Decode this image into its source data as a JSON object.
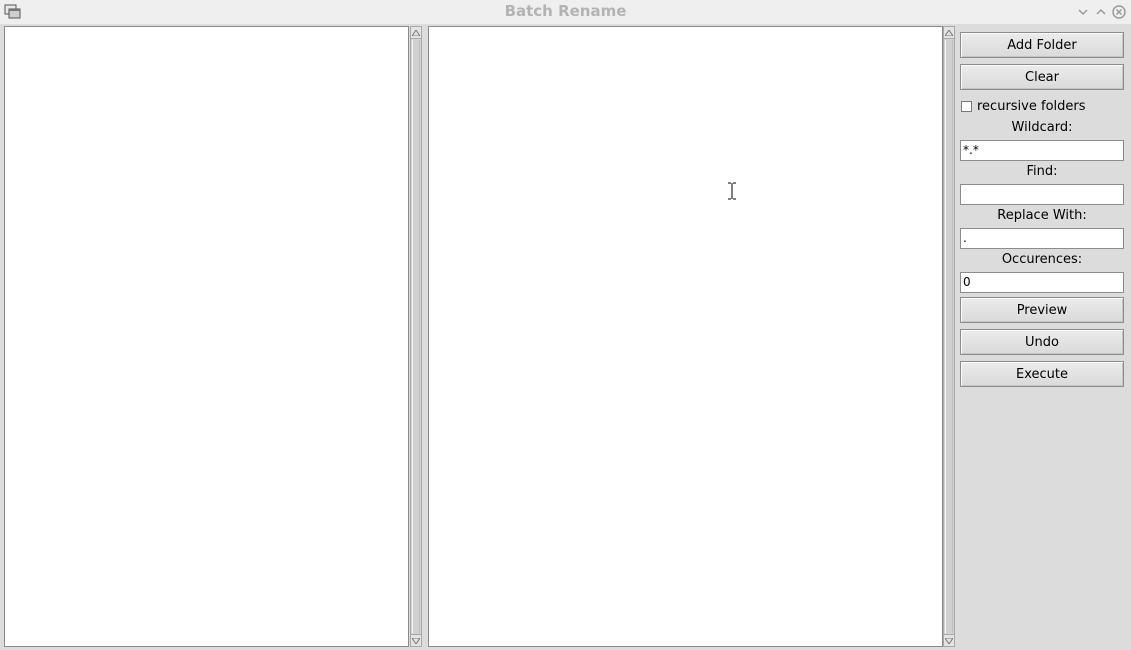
{
  "window": {
    "title": "Batch Rename"
  },
  "panel": {
    "add_folder_label": "Add Folder",
    "clear_label": "Clear",
    "recursive_label": "recursive folders",
    "recursive_checked": false,
    "wildcard_label": "Wildcard:",
    "wildcard_value": "*.*",
    "find_label": "Find:",
    "find_value": "",
    "replace_label": "Replace With:",
    "replace_value": ".",
    "occurrences_label": "Occurences:",
    "occurrences_value": "0",
    "preview_label": "Preview",
    "undo_label": "Undo",
    "execute_label": "Execute"
  },
  "colors": {
    "background": "#dcdcdc",
    "title_text": "#b3b3b3",
    "list_background": "#ffffff"
  },
  "icons": [
    "app-icon",
    "minimize-icon",
    "maximize-icon",
    "close-icon",
    "scroll-up-icon",
    "scroll-down-icon",
    "text-cursor-icon"
  ]
}
